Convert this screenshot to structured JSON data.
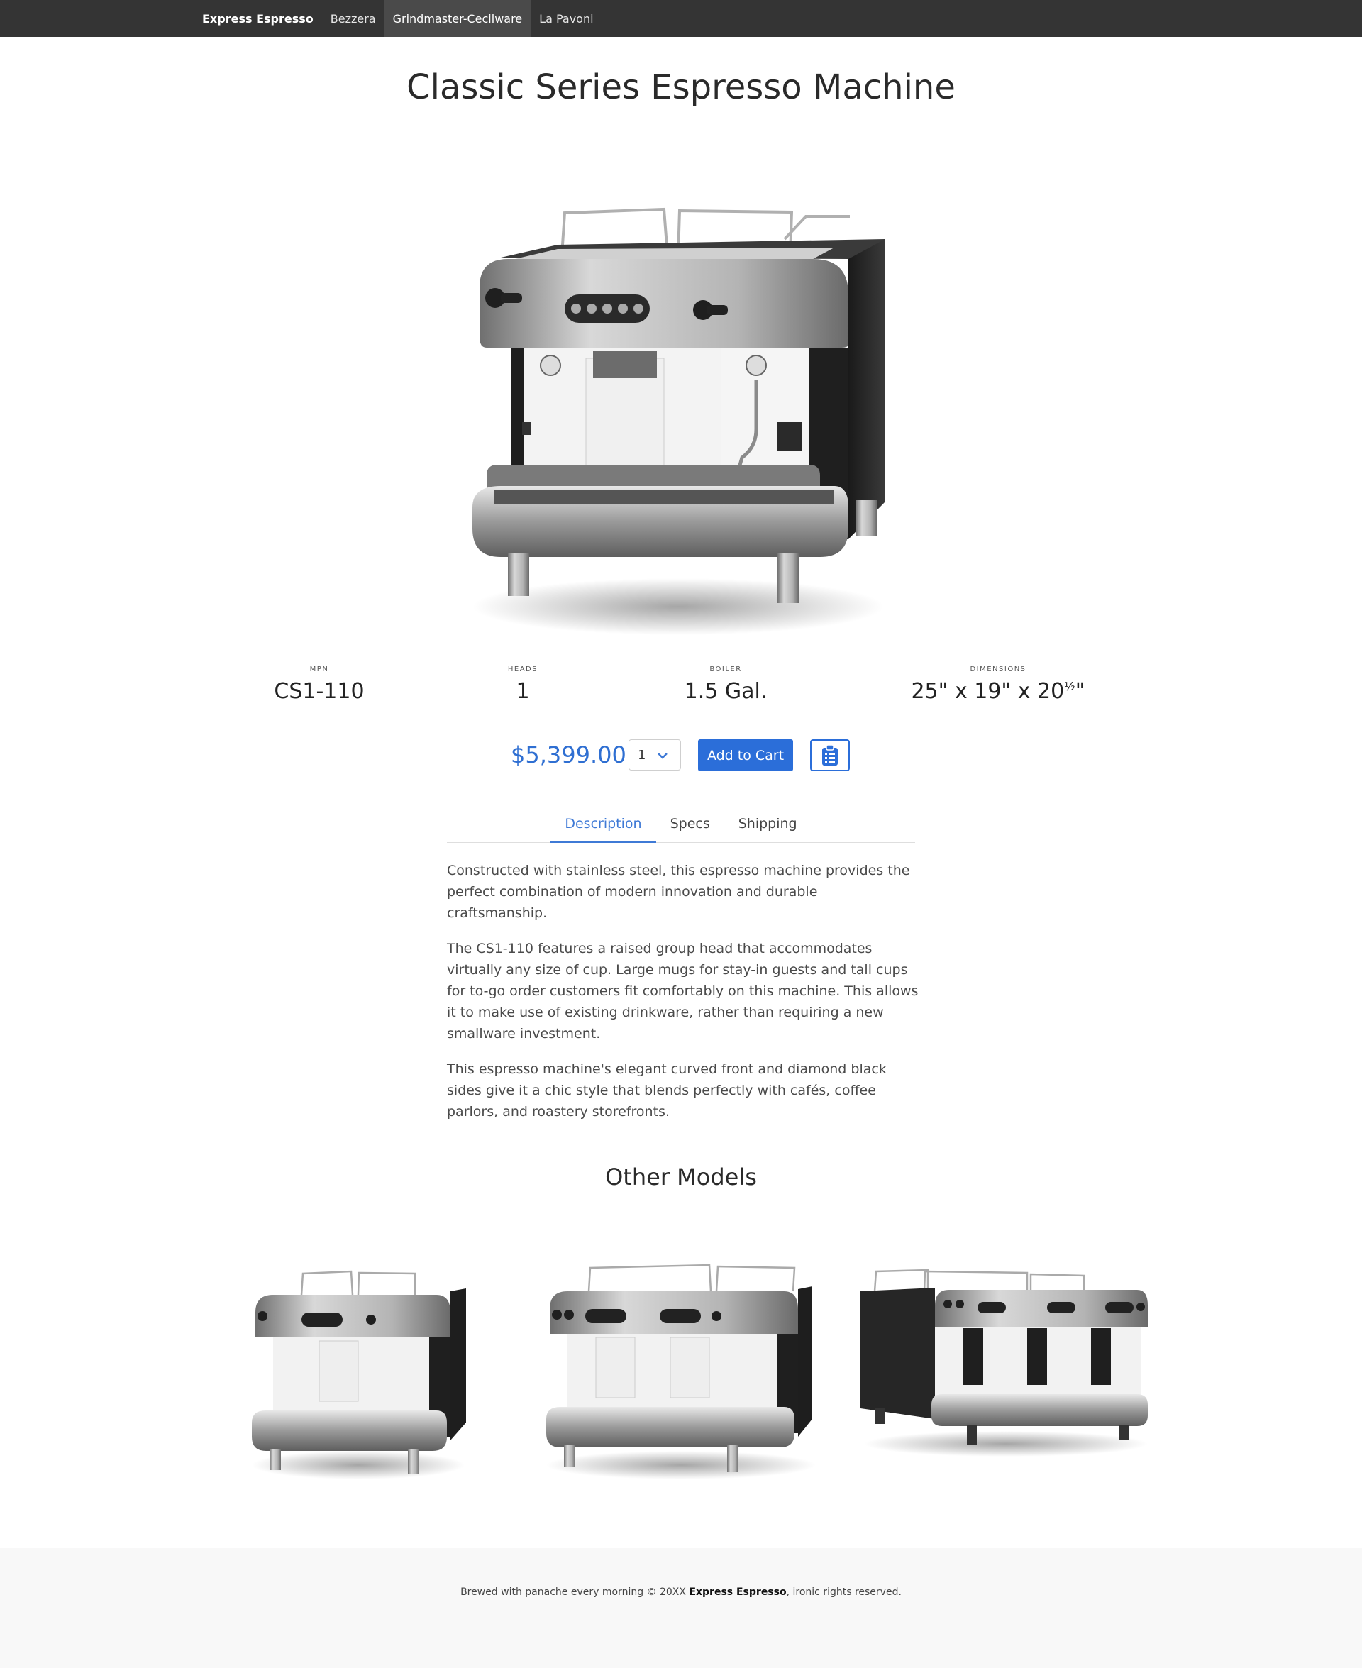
{
  "nav": {
    "brand": "Express Espresso",
    "links": [
      "Bezzera",
      "Grindmaster-Cecilware",
      "La Pavoni"
    ],
    "active_index": 1
  },
  "product": {
    "title": "Classic Series Espresso Machine",
    "specs": [
      {
        "label": "MPN",
        "value": "CS1-110"
      },
      {
        "label": "HEADS",
        "value": "1"
      },
      {
        "label": "BOILER",
        "value": "1.5 Gal."
      },
      {
        "label": "DIMENSIONS",
        "value": "25\" x 19\" x 20",
        "sup": "½",
        "suffix": "\""
      }
    ],
    "price": "$5,399.00",
    "quantity": "1",
    "add_to_cart": "Add to Cart"
  },
  "tabs": [
    "Description",
    "Specs",
    "Shipping"
  ],
  "active_tab": "Description",
  "description": [
    "Constructed with stainless steel, this espresso machine provides the perfect combination of modern innovation and durable craftsmanship.",
    "The CS1-110 features a raised group head that accommodates virtually any size of cup. Large mugs for stay-in guests and tall cups for to-go order customers fit comfortably on this machine. This allows it to make use of existing drinkware, rather than requiring a new smallware investment.",
    "This espresso machine's elegant curved front and diamond black sides give it a chic style that blends perfectly with cafés, coffee parlors, and roastery storefronts."
  ],
  "other_models": {
    "title": "Other Models"
  },
  "footer": {
    "prefix": "Brewed with panache every morning © 20XX ",
    "brand": "Express Espresso",
    "suffix": ", ironic rights reserved."
  },
  "colors": {
    "navbar": "#343434",
    "accent": "#2b6ed9",
    "price": "#2f6fd2",
    "footer_bg": "#f8f8f8"
  }
}
